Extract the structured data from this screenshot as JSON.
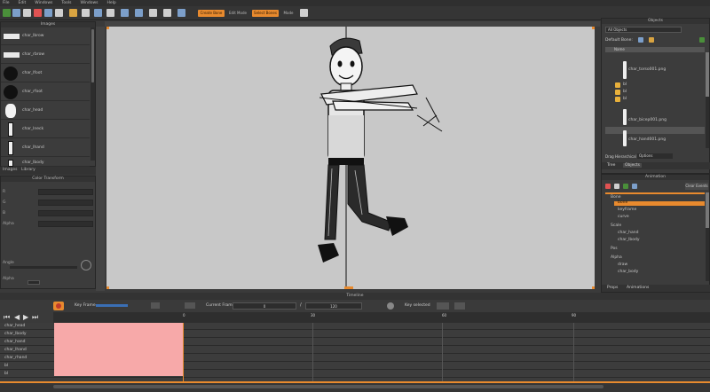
{
  "menubar": {
    "items": [
      "File",
      "Edit",
      "Windows",
      "Tools",
      "Windows",
      "Help"
    ]
  },
  "toolbar": {
    "buttons": [
      {
        "name": "new",
        "color": "#4a8f3a"
      },
      {
        "name": "open",
        "color": "#d9a441"
      },
      {
        "name": "save",
        "color": "#cfcfcf"
      }
    ],
    "mode_primary": "Create Bone",
    "mode_secondary": "Edit Mode",
    "mode_primary_2": "Select Bones",
    "mode_secondary_2": "Mode"
  },
  "left_images": {
    "title": "Images",
    "items": [
      {
        "label": "char_lbrow"
      },
      {
        "label": "char_rbrow"
      },
      {
        "label": "char_lfoot"
      },
      {
        "label": "char_rfoot"
      },
      {
        "label": "char_head"
      },
      {
        "label": "char_lneck"
      },
      {
        "label": "char_lhand"
      },
      {
        "label": "char_lbody"
      }
    ],
    "tabs": [
      "Images",
      "Library"
    ]
  },
  "left_props": {
    "title": "Color Transform",
    "rows": [
      "R",
      "G",
      "B",
      "Alpha"
    ],
    "angle_label": "Angle",
    "alpha_label": "Alpha"
  },
  "right_tree": {
    "title": "Objects",
    "dropdown": "All Objects",
    "default_bone": "Default Bone:",
    "header": "Name",
    "items": [
      "char_torso001.png",
      "bl",
      "bl",
      "bl",
      "char_bicep001.png",
      "char_hand001.png"
    ],
    "filter_label": "Drag Hierarchical Items",
    "filter_value": "Options",
    "tabs": [
      "Tree",
      "Objects"
    ]
  },
  "right_props": {
    "title": "Animation",
    "clip_button": "Clear Events",
    "items": [
      "Bone",
      "bone",
      "keyframe",
      "curve",
      "Scale",
      "char_hand",
      "char_lbody",
      "Pos",
      "Alpha",
      "draw",
      "char_body"
    ],
    "tabs": [
      "Props",
      "Animations"
    ]
  },
  "timeline": {
    "title": "Timeline",
    "keyframe_label": "Key Frame",
    "current_frame_label": "Current Frame",
    "current_frame_value": "0",
    "total_frames_value": "120",
    "fps_label": "Key selected",
    "rows": [
      "char_head",
      "char_lbody",
      "char_hand",
      "char_lhand",
      "char_rhand",
      "bl",
      "bl"
    ],
    "ticks": [
      "0",
      "30",
      "60",
      "90"
    ]
  },
  "colors": {
    "accent": "#e88a2e",
    "canvas": "#c8c8c8",
    "range": "#f7a9a9"
  }
}
